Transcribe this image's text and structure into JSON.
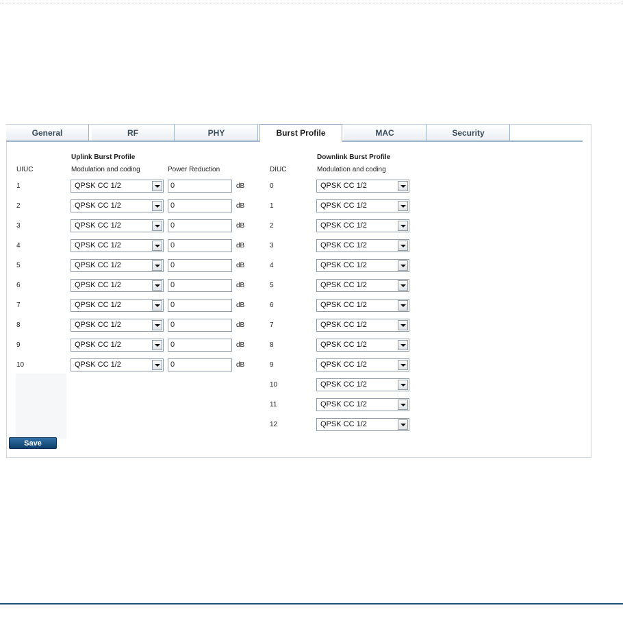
{
  "tabs": [
    "General",
    "RF",
    "PHY",
    "Burst Profile",
    "MAC",
    "Security"
  ],
  "uplink": {
    "title": "Uplink Burst Profile",
    "col_code": "UIUC",
    "col_mod": "Modulation and coding",
    "col_power": "Power Reduction",
    "unit": "dB",
    "rows": [
      {
        "code": "1",
        "mod": "QPSK CC 1/2",
        "power": "0"
      },
      {
        "code": "2",
        "mod": "QPSK CC 1/2",
        "power": "0"
      },
      {
        "code": "3",
        "mod": "QPSK CC 1/2",
        "power": "0"
      },
      {
        "code": "4",
        "mod": "QPSK CC 1/2",
        "power": "0"
      },
      {
        "code": "5",
        "mod": "QPSK CC 1/2",
        "power": "0"
      },
      {
        "code": "6",
        "mod": "QPSK CC 1/2",
        "power": "0"
      },
      {
        "code": "7",
        "mod": "QPSK CC 1/2",
        "power": "0"
      },
      {
        "code": "8",
        "mod": "QPSK CC 1/2",
        "power": "0"
      },
      {
        "code": "9",
        "mod": "QPSK CC 1/2",
        "power": "0"
      },
      {
        "code": "10",
        "mod": "QPSK CC 1/2",
        "power": "0"
      }
    ]
  },
  "downlink": {
    "title": "Downlink Burst Profile",
    "col_code": "DIUC",
    "col_mod": "Modulation and coding",
    "rows": [
      {
        "code": "0",
        "mod": "QPSK CC 1/2"
      },
      {
        "code": "1",
        "mod": "QPSK CC 1/2"
      },
      {
        "code": "2",
        "mod": "QPSK CC 1/2"
      },
      {
        "code": "3",
        "mod": "QPSK CC 1/2"
      },
      {
        "code": "4",
        "mod": "QPSK CC 1/2"
      },
      {
        "code": "5",
        "mod": "QPSK CC 1/2"
      },
      {
        "code": "6",
        "mod": "QPSK CC 1/2"
      },
      {
        "code": "7",
        "mod": "QPSK CC 1/2"
      },
      {
        "code": "8",
        "mod": "QPSK CC 1/2"
      },
      {
        "code": "9",
        "mod": "QPSK CC 1/2"
      },
      {
        "code": "10",
        "mod": "QPSK CC 1/2"
      },
      {
        "code": "11",
        "mod": "QPSK CC 1/2"
      },
      {
        "code": "12",
        "mod": "QPSK CC 1/2"
      }
    ]
  },
  "save_label": "Save"
}
